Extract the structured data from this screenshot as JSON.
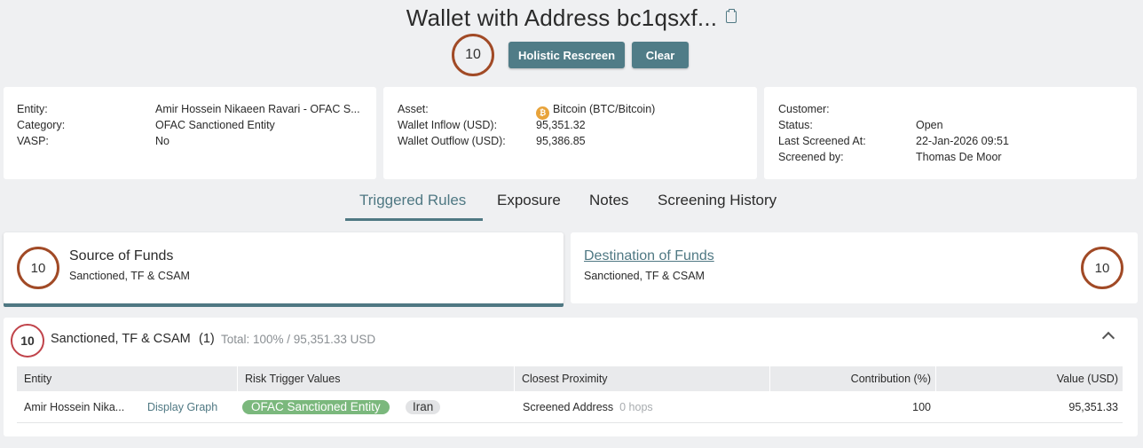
{
  "header": {
    "title": "Wallet with Address bc1qsxf...",
    "score": "10",
    "rescreen_label": "Holistic Rescreen",
    "clear_label": "Clear"
  },
  "entity_card": {
    "entity_label": "Entity:",
    "entity_value": "Amir Hossein Nikaeen Ravari - OFAC S...",
    "category_label": "Category:",
    "category_value": "OFAC Sanctioned Entity",
    "vasp_label": "VASP:",
    "vasp_value": "No"
  },
  "asset_card": {
    "asset_label": "Asset:",
    "asset_value": "Bitcoin (BTC/Bitcoin)",
    "asset_icon": "bitcoin-icon",
    "inflow_label": "Wallet Inflow (USD):",
    "inflow_value": "95,351.32",
    "outflow_label": "Wallet Outflow (USD):",
    "outflow_value": "95,386.85"
  },
  "customer_card": {
    "customer_label": "Customer:",
    "customer_value": "",
    "status_label": "Status:",
    "status_value": "Open",
    "last_screened_label": "Last Screened At:",
    "last_screened_value": "22-Jan-2026 09:51",
    "screened_by_label": "Screened by:",
    "screened_by_value": "Thomas De Moor"
  },
  "tabs": [
    {
      "label": "Triggered Rules",
      "active": true
    },
    {
      "label": "Exposure",
      "active": false
    },
    {
      "label": "Notes",
      "active": false
    },
    {
      "label": "Screening History",
      "active": false
    }
  ],
  "rules": {
    "source": {
      "score": "10",
      "title": "Source of Funds",
      "subtitle": "Sanctioned, TF & CSAM"
    },
    "destination": {
      "score": "10",
      "title": "Destination of Funds",
      "subtitle": "Sanctioned, TF & CSAM"
    }
  },
  "panel": {
    "score": "10",
    "title": "Sanctioned, TF & CSAM",
    "count": "(1)",
    "total": "Total: 100% / 95,351.33 USD",
    "columns": [
      "Entity",
      "Risk Trigger Values",
      "Closest Proximity",
      "Contribution (%)",
      "Value (USD)"
    ],
    "rows": [
      {
        "entity": "Amir Hossein Nika...",
        "display_graph": "Display Graph",
        "trigger_primary": "OFAC Sanctioned Entity",
        "trigger_secondary": "Iran",
        "proximity": "Screened Address",
        "hops": "0 hops",
        "contribution": "100",
        "value": "95,351.33"
      }
    ]
  },
  "colors": {
    "accent": "#507c87",
    "score_ring": "#a14a26",
    "score_ring_alt": "#c0434a",
    "pill_green": "#7bb87d",
    "background": "#eff0f2"
  }
}
